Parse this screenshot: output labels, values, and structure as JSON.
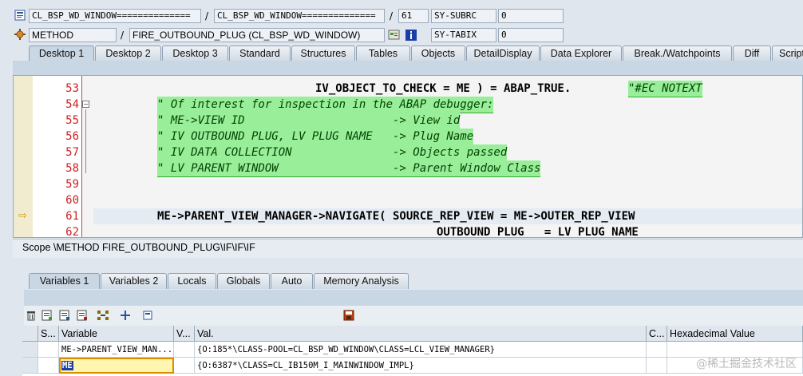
{
  "header": {
    "row1": {
      "program_a": "CL_BSP_WD_WINDOW==============",
      "program_b": "CL_BSP_WD_WINDOW==============",
      "line": "61",
      "sysvar_label": "SY-SUBRC",
      "sysvar_value": "0"
    },
    "row2": {
      "kind": "METHOD",
      "name": "FIRE_OUTBOUND_PLUG (CL_BSP_WD_WINDOW)",
      "sysvar_label": "SY-TABIX",
      "sysvar_value": "0"
    },
    "slash": "/"
  },
  "desktop_tabs": [
    "Desktop 1",
    "Desktop 2",
    "Desktop 3",
    "Standard",
    "Structures",
    "Tables",
    "Objects",
    "DetailDisplay",
    "Data Explorer",
    "Break./Watchpoints",
    "Diff",
    "Script"
  ],
  "code": {
    "lines": [
      {
        "num": "53",
        "a": "IV_OBJECT_TO_CHECK = ME ) = ABAP_TRUE. ",
        "comment": "\"#EC NOTEXT"
      },
      {
        "num": "54",
        "comment": "\" Of interest for inspection in the ABAP debugger:"
      },
      {
        "num": "55",
        "comment": "\" ME->VIEW ID                      -> View id"
      },
      {
        "num": "56",
        "comment": "\" IV OUTBOUND PLUG, LV PLUG NAME   -> Plug Name"
      },
      {
        "num": "57",
        "comment": "\" IV DATA COLLECTION               -> Objects passed"
      },
      {
        "num": "58",
        "comment": "\" LV PARENT WINDOW                 -> Parent Window Class"
      },
      {
        "num": "59"
      },
      {
        "num": "60"
      },
      {
        "num": "61",
        "a": "ME->PARENT_VIEW_MANAGER->NAVIGATE( SOURCE_REP_VIEW = ME->OUTER_REP_VIEW"
      },
      {
        "num": "62",
        "a": "OUTBOUND PLUG   = LV PLUG NAME"
      }
    ]
  },
  "scope": "Scope \\METHOD FIRE_OUTBOUND_PLUG\\IF\\IF\\IF",
  "variable_tabs": [
    "Variables 1",
    "Variables 2",
    "Locals",
    "Globals",
    "Auto",
    "Memory Analysis"
  ],
  "table": {
    "headers": [
      "S...",
      "Variable",
      "V...",
      "Val.",
      "C...",
      "Hexadecimal Value"
    ],
    "rows": [
      {
        "variable": "ME->PARENT_VIEW_MAN...",
        "value": "{O:185*\\CLASS-POOL=CL_BSP_WD_WINDOW\\CLASS=LCL_VIEW_MANAGER}"
      },
      {
        "variable": "ME",
        "value": "{O:6387*\\CLASS=CL_IB150M_I_MAINWINDOW_IMPL}"
      }
    ]
  },
  "watermark": "@稀土掘金技术社区",
  "icons": {
    "program": "program-icon",
    "method": "method-icon",
    "info": "info-icon"
  }
}
